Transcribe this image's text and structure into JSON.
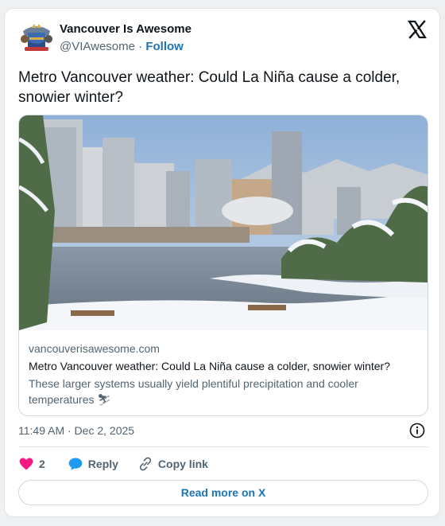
{
  "author": {
    "name": "Vancouver Is Awesome",
    "handle": "@VIAwesome",
    "separator": "·",
    "follow_label": "Follow"
  },
  "tweet": {
    "text": "Metro Vancouver weather: Could La Niña cause a colder, snowier winter?"
  },
  "link_card": {
    "domain": "vancouverisawesome.com",
    "title": "Metro Vancouver weather: Could La Niña cause a colder, snowier winter?",
    "description": "These larger systems usually yield plentiful precipitation and cooler temperatures",
    "description_emoji": "⛷"
  },
  "meta": {
    "timestamp": "11:49 AM · Dec 2, 2025"
  },
  "actions": {
    "like_count": "2",
    "reply_label": "Reply",
    "copy_label": "Copy link"
  },
  "footer": {
    "read_more_label": "Read more on X"
  },
  "colors": {
    "link_blue": "#1d75b8",
    "like_pink": "#f91880",
    "reply_blue": "#1d9bf0",
    "muted": "#536471"
  }
}
